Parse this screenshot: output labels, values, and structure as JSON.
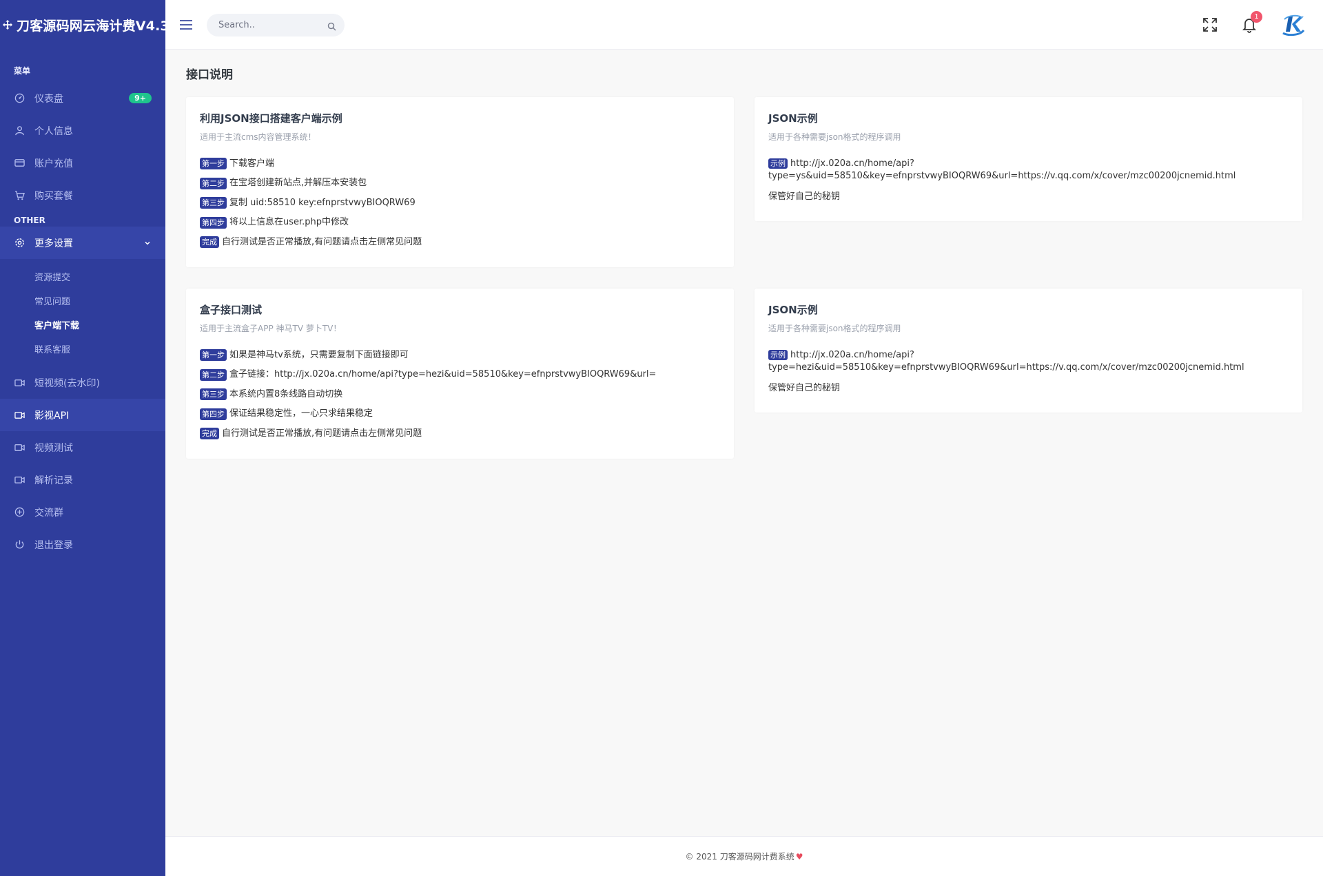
{
  "brand": {
    "title": "刀客源码网云海计费V4.3"
  },
  "sidebar": {
    "menu_label": "菜单",
    "other_label": "OTHER",
    "items": [
      {
        "label": "仪表盘",
        "icon": "dashboard-icon",
        "badge": "9+"
      },
      {
        "label": "个人信息",
        "icon": "user-icon"
      },
      {
        "label": "账户充值",
        "icon": "credit-card-icon"
      },
      {
        "label": "购买套餐",
        "icon": "cart-icon"
      }
    ],
    "settings": {
      "label": "更多设置",
      "icon": "gear-icon",
      "sub_items": [
        "资源提交",
        "常见问题",
        "客户端下载",
        "联系客服"
      ]
    },
    "other_items": [
      {
        "label": "短视频(去水印)",
        "icon": "video-icon"
      },
      {
        "label": "影视API",
        "icon": "video-icon"
      },
      {
        "label": "视频测试",
        "icon": "video-icon"
      },
      {
        "label": "解析记录",
        "icon": "video-icon"
      },
      {
        "label": "交流群",
        "icon": "plus-circle-icon"
      },
      {
        "label": "退出登录",
        "icon": "power-icon"
      }
    ]
  },
  "topbar": {
    "search_placeholder": "Search..",
    "notification_count": "1"
  },
  "page": {
    "title": "接口说明"
  },
  "cards": {
    "client": {
      "title": "利用JSON接口搭建客户端示例",
      "subtitle": "适用于主流cms内容管理系统！",
      "steps": [
        {
          "tag": "第一步",
          "text": "下载客户端"
        },
        {
          "tag": "第二步",
          "text": "在宝塔创建新站点,并解压本安装包"
        },
        {
          "tag": "第三步",
          "text": "复制 uid:58510 key:efnprstvwyBIOQRW69"
        },
        {
          "tag": "第四步",
          "text": "将以上信息在user.php中修改"
        },
        {
          "tag": "完成",
          "text": "自行测试是否正常播放,有问题请点击左侧常见问题"
        }
      ]
    },
    "json1": {
      "title": "JSON示例",
      "subtitle": "适用于各种需要json格式的程序调用",
      "tag": "示例",
      "url_line1": "http://jx.020a.cn/home/api?",
      "url_line2": "type=ys&uid=58510&key=efnprstvwyBIOQRW69&url=https://v.qq.com/x/cover/mzc00200jcnemid.html",
      "note": "保管好自己的秘钥"
    },
    "box": {
      "title": "盒子接口测试",
      "subtitle": "适用于主流盒子APP 神马TV 萝卜TV！",
      "steps": [
        {
          "tag": "第一步",
          "text": "如果是神马tv系统，只需要复制下面链接即可"
        },
        {
          "tag": "第二步",
          "text": "盒子链接：http://jx.020a.cn/home/api?type=hezi&uid=58510&key=efnprstvwyBIOQRW69&url="
        },
        {
          "tag": "第三步",
          "text": "本系统内置8条线路自动切换"
        },
        {
          "tag": "第四步",
          "text": "保证结果稳定性，一心只求结果稳定"
        },
        {
          "tag": "完成",
          "text": "自行测试是否正常播放,有问题请点击左侧常见问题"
        }
      ]
    },
    "json2": {
      "title": "JSON示例",
      "subtitle": "适用于各种需要json格式的程序调用",
      "tag": "示例",
      "url_line1": "http://jx.020a.cn/home/api?",
      "url_line2": "type=hezi&uid=58510&key=efnprstvwyBIOQRW69&url=https://v.qq.com/x/cover/mzc00200jcnemid.html",
      "note": "保管好自己的秘钥"
    }
  },
  "footer": {
    "text": "© 2021 刀客源码网计费系统"
  },
  "colors": {
    "sidebar": "#2f3d9c",
    "badge": "#1fc48d",
    "notify": "#f1556c",
    "heart": "#e74c5e"
  }
}
